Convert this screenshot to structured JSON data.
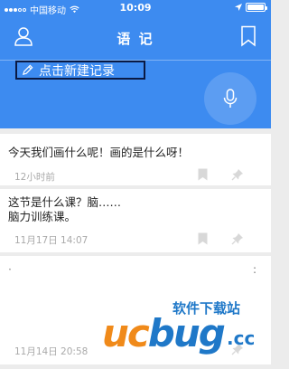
{
  "status_bar": {
    "carrier": "中国移动",
    "time": "10:09"
  },
  "nav": {
    "title": "语 记"
  },
  "new_record": {
    "label": "点击新建记录"
  },
  "notes": [
    {
      "text": "今天我们画什么呢！画的是什么呀！",
      "time": "12小时前"
    },
    {
      "text_line1": "这节是什么课？脑……",
      "text_line2": "脑力训练课。",
      "time": "11月17日 14:07"
    },
    {
      "text": "·",
      "more": ":",
      "time": "11月14日 20:58"
    }
  ],
  "watermark": {
    "cn": "软件下载站",
    "logo_a": "uc",
    "logo_b": "bug",
    "cc": ".cc"
  },
  "colors": {
    "accent": "#3d8bf0"
  }
}
